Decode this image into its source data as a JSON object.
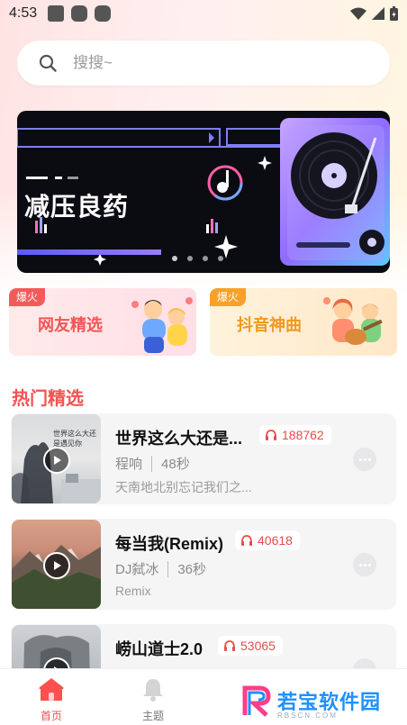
{
  "status_bar": {
    "time": "4:53"
  },
  "search": {
    "placeholder": "搜搜~"
  },
  "banner": {
    "title": "减压良药",
    "slides": 4,
    "active_slide": 0
  },
  "categories": [
    {
      "badge": "爆火",
      "label": "网友精选"
    },
    {
      "badge": "爆火",
      "label": "抖音神曲"
    }
  ],
  "section": {
    "title": "热门精选"
  },
  "songs": [
    {
      "title": "世界这么大还是...",
      "plays": "188762",
      "artist": "程响",
      "duration": "48秒",
      "desc": "天南地北别忘记我们之...",
      "cover_text": "世界这么大还是遇见你"
    },
    {
      "title": "每当我(Remix)",
      "plays": "40618",
      "artist": "DJ弑冰",
      "duration": "36秒",
      "desc": "Remix"
    },
    {
      "title": "崂山道士2.0",
      "plays": "53065",
      "artist": "",
      "duration": "",
      "desc": ""
    }
  ],
  "nav": [
    {
      "label": "首页",
      "active": true
    },
    {
      "label": "主题",
      "active": false
    }
  ],
  "watermark": {
    "text": "若宝软件园",
    "sub": "RBSCN.COM"
  },
  "colors": {
    "accent": "#f25252",
    "orange": "#f0991f",
    "watermark": "#1e90ff"
  }
}
